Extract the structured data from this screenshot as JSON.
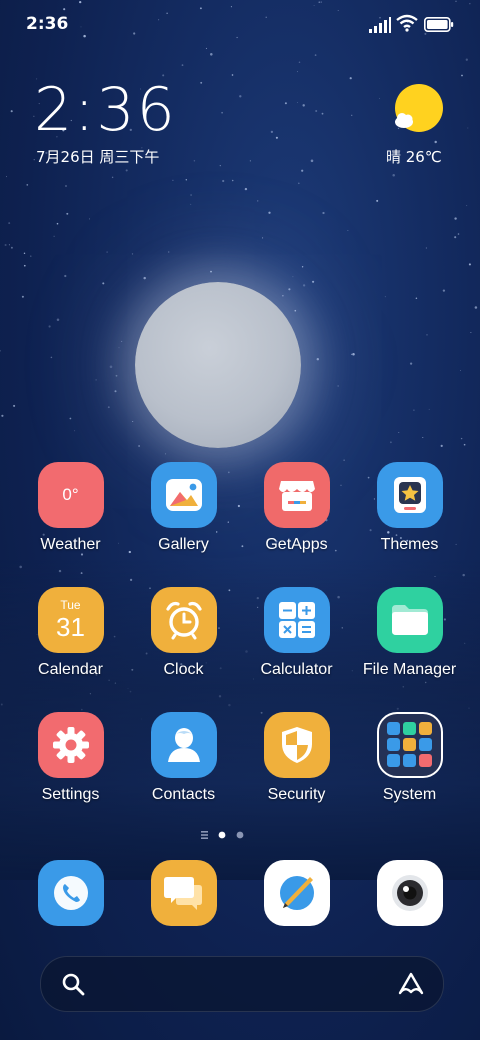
{
  "status_bar": {
    "time": "2:36"
  },
  "lockclock": {
    "time": "2:36",
    "date": "7月26日 周三下午"
  },
  "weather_widget": {
    "text": "晴 26℃"
  },
  "apps": [
    {
      "label": "Weather",
      "icon": "weather-icon",
      "badge": "0°",
      "color": "#f26b6f"
    },
    {
      "label": "Gallery",
      "icon": "gallery-icon",
      "color": "#3a9ae8"
    },
    {
      "label": "GetApps",
      "icon": "getapps-icon",
      "color": "#f06a6a"
    },
    {
      "label": "Themes",
      "icon": "themes-icon",
      "color": "#3a9ae8"
    },
    {
      "label": "Calendar",
      "icon": "calendar-icon",
      "day": "Tue",
      "date": "31",
      "color": "#f0b03c"
    },
    {
      "label": "Clock",
      "icon": "clock-icon",
      "color": "#f0b03c"
    },
    {
      "label": "Calculator",
      "icon": "calculator-icon",
      "color": "#3a9ae8"
    },
    {
      "label": "File Manager",
      "icon": "file-manager-icon",
      "color": "#2fd1a0"
    },
    {
      "label": "Settings",
      "icon": "settings-icon",
      "color": "#f26b6f"
    },
    {
      "label": "Contacts",
      "icon": "contacts-icon",
      "color": "#3a9ae8"
    },
    {
      "label": "Security",
      "icon": "security-icon",
      "color": "#f0b03c"
    },
    {
      "label": "System",
      "icon": "system-folder-icon",
      "color": "#1c2a4a"
    }
  ],
  "dock": [
    {
      "icon": "phone-icon",
      "color": "#3a9ae8"
    },
    {
      "icon": "messages-icon",
      "color": "#f0b03c"
    },
    {
      "icon": "browser-icon",
      "color": "#ffffff"
    },
    {
      "icon": "camera-icon",
      "color": "#ffffff"
    }
  ]
}
